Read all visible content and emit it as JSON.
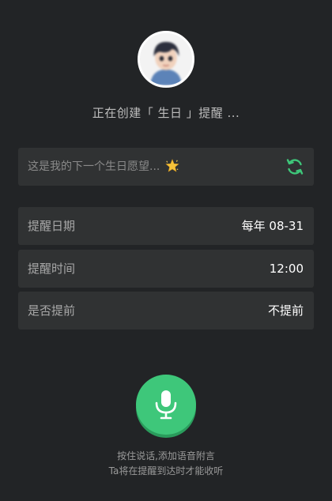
{
  "header": {
    "avatar_icon": "user-avatar",
    "status_prefix": "正在创建「 生日 」提醒 ..."
  },
  "wish": {
    "text": "这是我的下一个生日愿望...",
    "star_icon": "star-icon",
    "refresh_icon": "refresh-icon",
    "refresh_color": "#3ec77a"
  },
  "settings": [
    {
      "label": "提醒日期",
      "value": "每年 08-31"
    },
    {
      "label": "提醒时间",
      "value": "12:00"
    },
    {
      "label": "是否提前",
      "value": "不提前"
    }
  ],
  "voice": {
    "mic_icon": "microphone-icon",
    "accent_color": "#3ec77a",
    "hint_line1": "按住说话,添加语音附言",
    "hint_line2": "Ta将在提醒到达时才能收听"
  }
}
